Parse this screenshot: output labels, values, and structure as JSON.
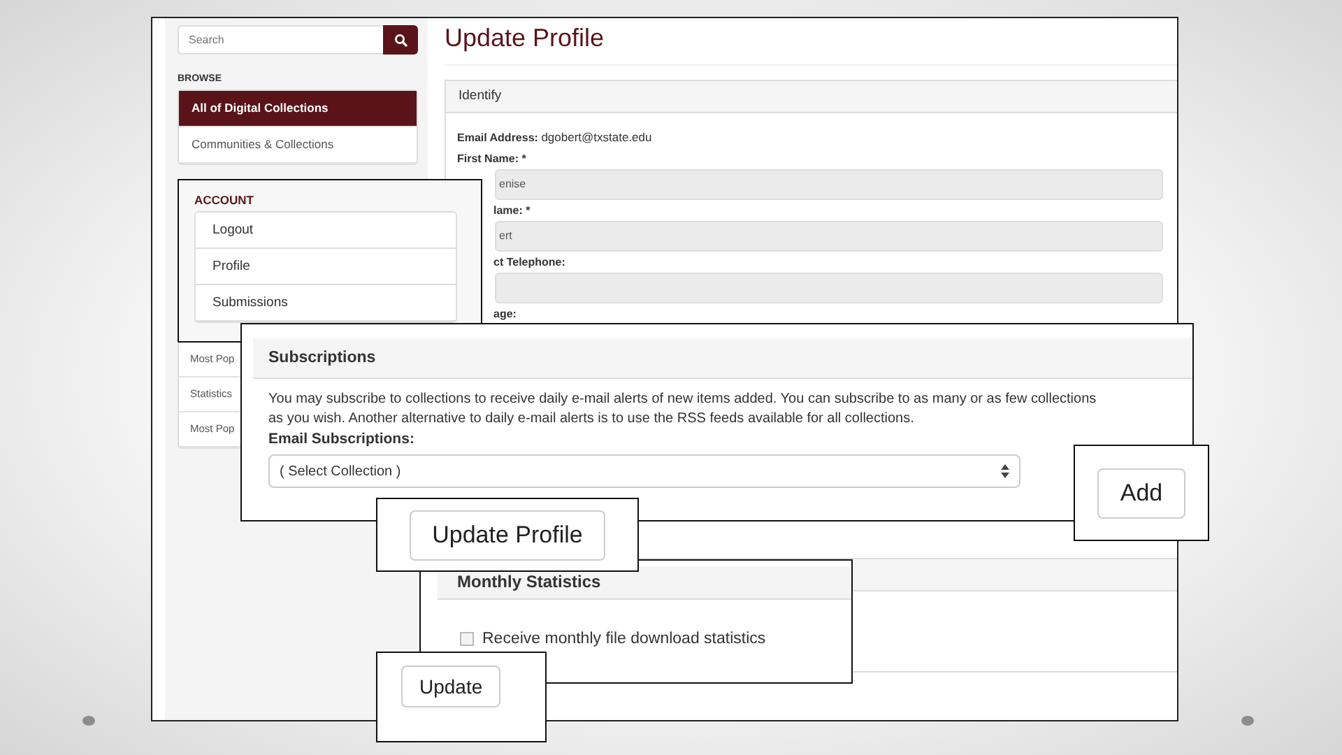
{
  "search": {
    "placeholder": "Search"
  },
  "browse": {
    "heading": "BROWSE",
    "items": [
      {
        "label": "All of Digital Collections",
        "selected": true
      },
      {
        "label": "Communities & Collections",
        "selected": false
      }
    ]
  },
  "sidebar_more": [
    "Most Pop",
    "Statistics",
    "Most Pop"
  ],
  "page_title": "Update Profile",
  "identify": {
    "heading": "Identify",
    "email_label": "Email Address:",
    "email_value": "dgobert@txstate.edu",
    "fields": [
      {
        "label": "First Name: *",
        "value": "enise"
      },
      {
        "label": "lame: *",
        "value": "ert"
      },
      {
        "label": "ct Telephone:"
      }
    ],
    "last_label": "age:"
  },
  "account": {
    "heading": "ACCOUNT",
    "items": [
      "Logout",
      "Profile",
      "Submissions"
    ]
  },
  "subscriptions": {
    "heading": "Subscriptions",
    "text": "You may subscribe to collections to receive daily e-mail alerts of new items added. You can subscribe to as many or as few collections as you wish. Another alternative to daily e-mail alerts is to use the RSS feeds available for all collections.",
    "email_label": "Email Subscriptions:",
    "select": {
      "value": "( Select Collection )"
    }
  },
  "add_button": "Add",
  "update_profile_button": "Update Profile",
  "monthly": {
    "heading": "Monthly Statistics",
    "checkbox": {
      "label": "Receive monthly file download statistics",
      "checked": false
    }
  },
  "update_button": "Update"
}
